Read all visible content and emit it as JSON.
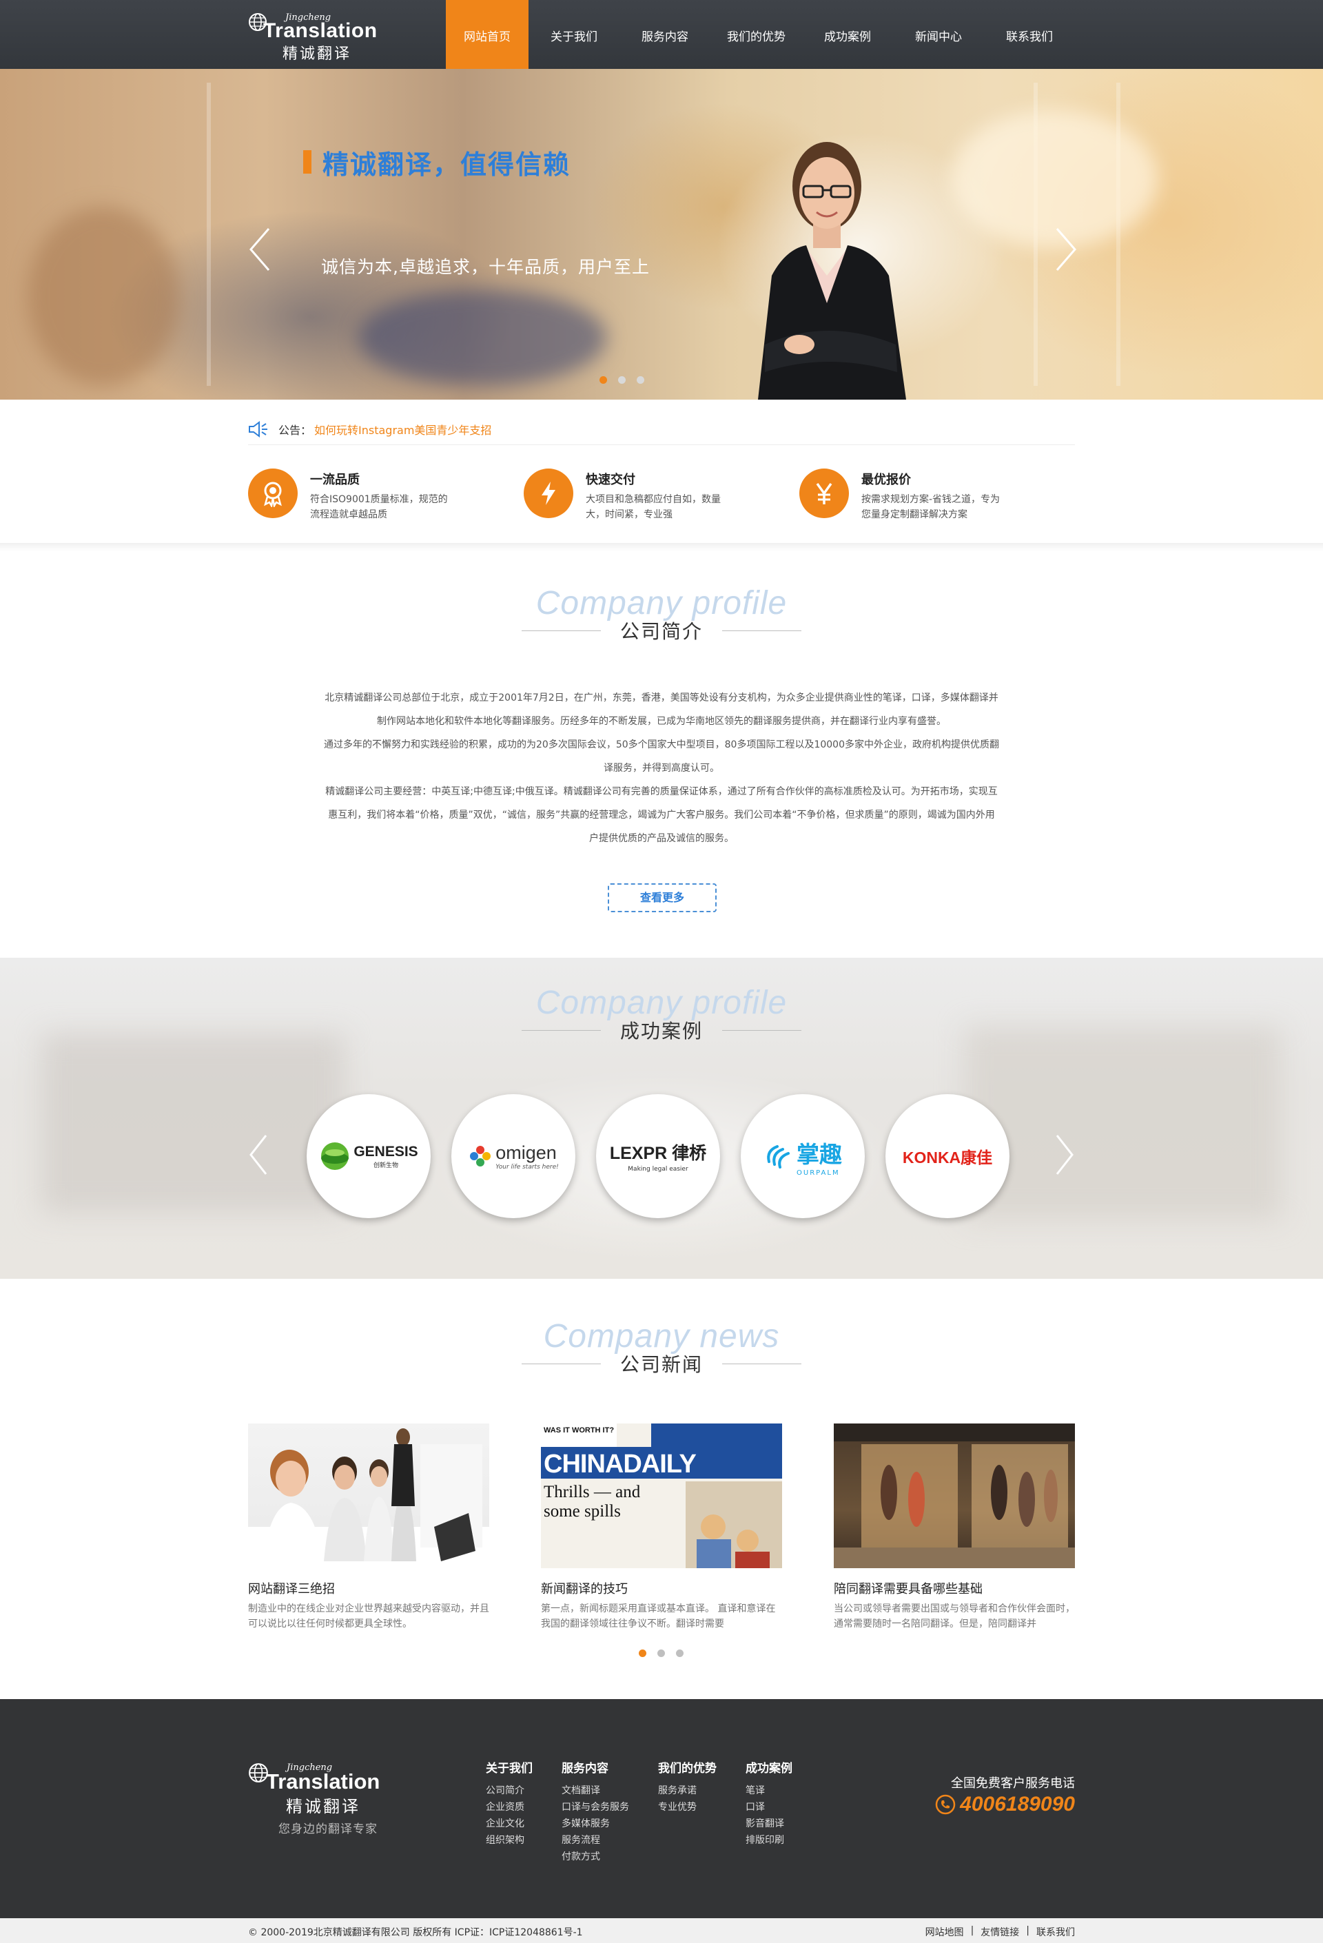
{
  "header": {
    "logo": {
      "sub": "Jingcheng",
      "en": "Translation",
      "cn": "精诚翻译"
    },
    "nav": [
      {
        "label": "网站首页",
        "active": true
      },
      {
        "label": "关于我们"
      },
      {
        "label": "服务内容"
      },
      {
        "label": "我们的优势"
      },
      {
        "label": "成功案例"
      },
      {
        "label": "新闻中心"
      },
      {
        "label": "联系我们"
      }
    ]
  },
  "banner": {
    "title": "精诚翻译，值得信赖",
    "subtitle": "诚信为本,卓越追求，十年品质，用户至上",
    "slides": 3,
    "active_slide": 1
  },
  "notice": {
    "label": "公告：",
    "link": "如何玩转Instagram美国青少年支招"
  },
  "features": [
    {
      "icon": "medal-icon",
      "title": "一流品质",
      "desc": "符合ISO9001质量标准，规范的流程造就卓越品质"
    },
    {
      "icon": "lightning-icon",
      "title": "快速交付",
      "desc": "大项目和急稿都应付自如，数量大，时间紧，专业强"
    },
    {
      "icon": "yen-icon",
      "title": "最优报价",
      "desc": "按需求规划方案-省钱之道，专为您量身定制翻译解决方案"
    }
  ],
  "profile": {
    "en": "Company profile",
    "cn": "公司简介",
    "paragraphs": [
      "北京精诚翻译公司总部位于北京，成立于2001年7月2日，在广州，东莞，香港，美国等处设有分支机构，为众多企业提供商业性的笔译，口译，多媒体翻译并制作网站本地化和软件本地化等翻译服务。历经多年的不断发展，已成为华南地区领先的翻译服务提供商，并在翻译行业内享有盛誉。",
      "通过多年的不懈努力和实践经验的积累，成功的为20多次国际会议，50多个国家大中型项目，80多项国际工程以及10000多家中外企业，政府机构提供优质翻译服务，并得到高度认可。",
      "精诚翻译公司主要经营：中英互译;中德互译;中俄互译。精诚翻译公司有完善的质量保证体系，通过了所有合作伙伴的高标准质检及认可。为开拓市场，实现互惠互利，我们将本着“价格，质量”双优，“诚信，服务”共赢的经营理念，竭诚为广大客户服务。我们公司本着“不争价格，但求质量”的原则，竭诚为国内外用户提供优质的产品及诚信的服务。"
    ],
    "more_button": "查看更多"
  },
  "cases": {
    "en": "Company profile",
    "cn": "成功案例",
    "clients": [
      {
        "name": "GENESIS",
        "sub": "创新生物"
      },
      {
        "name": "omigen",
        "sub": "Your life starts here!"
      },
      {
        "name": "LEXPR 律桥",
        "sub": "Making legal easier"
      },
      {
        "name": "掌趣",
        "sub": "OURPALM"
      },
      {
        "name": "KONKA康佳",
        "sub": ""
      }
    ]
  },
  "news": {
    "en": "Company news",
    "cn": "公司新闻",
    "items": [
      {
        "title": "网站翻译三绝招",
        "desc": "制造业中的在线企业对企业世界越来越受内容驱动，并且可以说比以往任何时候都更具全球性。"
      },
      {
        "title": "新闻翻译的技巧",
        "desc": "第一点，新闻标题采用直译或基本直译。 直译和意译在我国的翻译领域往往争议不断。翻译时需要"
      },
      {
        "title": "陪同翻译需要具备哪些基础",
        "desc": "当公司或领导者需要出国或与领导者和合作伙伴会面时，通常需要随时一名陪同翻译。但是，陪同翻译并"
      }
    ],
    "paper": {
      "top": "WAS IT WORTH IT?",
      "masthead": "CHINADAILY",
      "headline1": "Thrills — and",
      "headline2": "some spills"
    }
  },
  "footer": {
    "logo": {
      "sub": "Jingcheng",
      "en": "Translation",
      "cn": "精诚翻译",
      "slogan": "您身边的翻译专家"
    },
    "columns": [
      {
        "title": "关于我们",
        "items": [
          "公司简介",
          "企业资质",
          "企业文化",
          "组织架构"
        ]
      },
      {
        "title": "服务内容",
        "items": [
          "文档翻译",
          "口译与会务服务",
          "多媒体服务",
          "服务流程",
          "付款方式"
        ]
      },
      {
        "title": "我们的优势",
        "items": [
          "服务承诺",
          "专业优势"
        ]
      },
      {
        "title": "成功案例",
        "items": [
          "笔译",
          "口译",
          "影音翻译",
          "排版印刷"
        ]
      }
    ],
    "phone_label": "全国免费客户服务电话",
    "phone": "4006189090",
    "copyright": "© 2000-2019北京精诚翻译有限公司 版权所有 ICP证：ICP证12048861号-1",
    "links": [
      "网站地图",
      "|",
      "友情链接",
      "|",
      "联系我们"
    ]
  },
  "colors": {
    "accent": "#f08519",
    "blue": "#2e7fd8",
    "header": "#3a3d42",
    "footer": "#333436"
  }
}
